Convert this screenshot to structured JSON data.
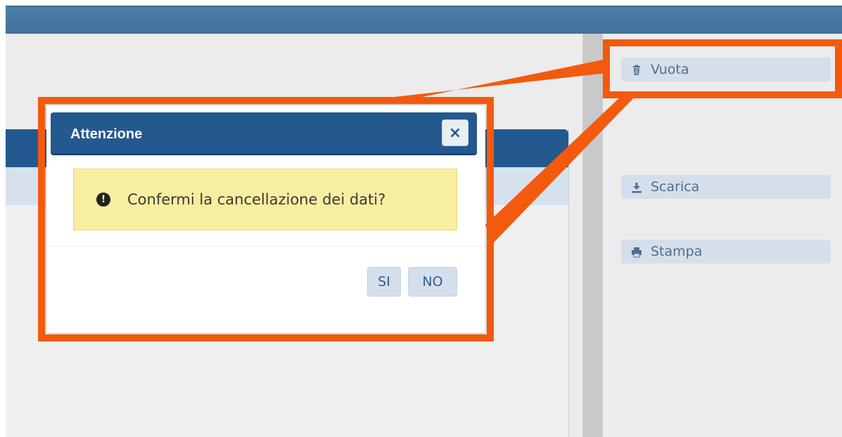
{
  "dialog": {
    "title": "Attenzione",
    "close_label": "×",
    "message": "Confermi la cancellazione dei dati?",
    "warning_glyph": "!",
    "buttons": {
      "yes": "SI",
      "no": "NO"
    }
  },
  "sidebar": {
    "buttons": [
      {
        "label": "Vuota",
        "icon": "trash-icon"
      },
      {
        "label": "Scarica",
        "icon": "download-icon"
      },
      {
        "label": "Stampa",
        "icon": "print-icon"
      }
    ]
  },
  "colors": {
    "highlight": "#f35a0d",
    "header_blue": "#24598f",
    "warning_bg": "#f8ee9f",
    "button_bg": "#d5dfeb"
  }
}
